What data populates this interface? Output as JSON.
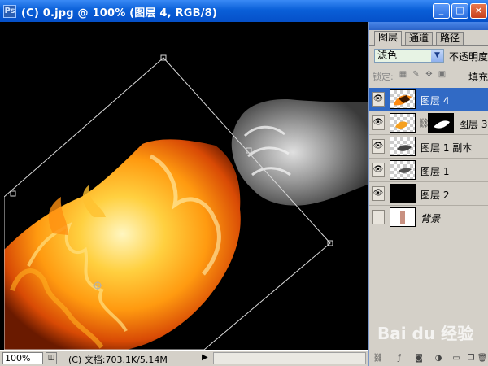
{
  "window": {
    "title": "(C) 0.jpg @ 100% (图层 4, RGB/8)",
    "buttons": {
      "minimize": "_",
      "maximize": "□",
      "close": "×"
    }
  },
  "panel": {
    "tabs": [
      {
        "label": "图层"
      },
      {
        "label": "通道"
      },
      {
        "label": "路径"
      }
    ],
    "blend_mode": "滤色",
    "opacity_label": "不透明度",
    "lock_label": "锁定:",
    "fill_label": "填充",
    "layers": [
      {
        "name": "图层 4",
        "visible": true,
        "selected": true
      },
      {
        "name": "图层 3",
        "visible": true,
        "selected": false,
        "has_mask": true
      },
      {
        "name": "图层 1 副本",
        "visible": true,
        "selected": false
      },
      {
        "name": "图层 1",
        "visible": true,
        "selected": false
      },
      {
        "name": "图层 2",
        "visible": true,
        "selected": false
      },
      {
        "name": "背景",
        "visible": false,
        "selected": false,
        "italic": true
      }
    ]
  },
  "statusbar": {
    "zoom": "100%",
    "doc_info": "(C) 文档:703.1K/5.14M"
  },
  "watermark": "Bai du 经验",
  "colors": {
    "titlebar": "#0a5fd8",
    "panel_bg": "#d4d0c8",
    "selected_layer": "#316ac5",
    "blend_field": "#e7f3e4"
  }
}
